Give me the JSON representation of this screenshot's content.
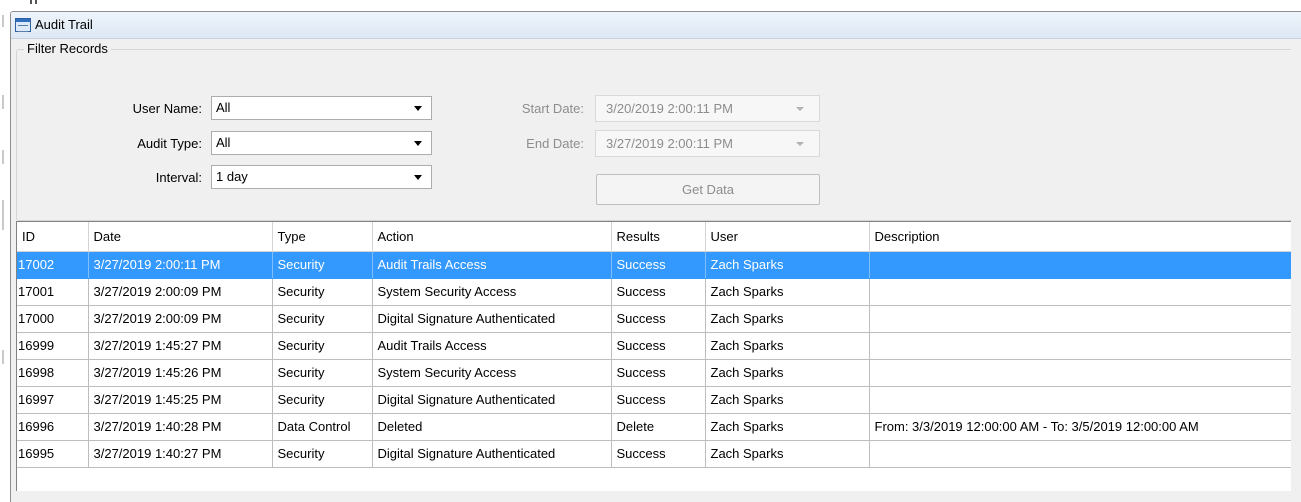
{
  "window": {
    "title": "Audit Trail"
  },
  "filter": {
    "legend": "Filter Records",
    "user_name": {
      "label": "User Name:",
      "value": "All"
    },
    "audit_type": {
      "label": "Audit Type:",
      "value": "All"
    },
    "interval": {
      "label": "Interval:",
      "value": "1 day"
    },
    "start_date": {
      "label": "Start Date:",
      "value": "3/20/2019  2:00:11 PM"
    },
    "end_date": {
      "label": "End Date:",
      "value": "3/27/2019  2:00:11 PM"
    },
    "get_data_label": "Get Data"
  },
  "grid": {
    "columns": [
      "ID",
      "Date",
      "Type",
      "Action",
      "Results",
      "User",
      "Description"
    ],
    "selected_index": 0,
    "rows": [
      {
        "id": "17002",
        "date": "3/27/2019 2:00:11 PM",
        "type": "Security",
        "action": "Audit Trails Access",
        "results": "Success",
        "user": "Zach Sparks",
        "description": ""
      },
      {
        "id": "17001",
        "date": "3/27/2019 2:00:09 PM",
        "type": "Security",
        "action": "System Security Access",
        "results": "Success",
        "user": "Zach Sparks",
        "description": ""
      },
      {
        "id": "17000",
        "date": "3/27/2019 2:00:09 PM",
        "type": "Security",
        "action": "Digital Signature Authenticated",
        "results": "Success",
        "user": "Zach Sparks",
        "description": ""
      },
      {
        "id": "16999",
        "date": "3/27/2019 1:45:27 PM",
        "type": "Security",
        "action": "Audit Trails Access",
        "results": "Success",
        "user": "Zach Sparks",
        "description": ""
      },
      {
        "id": "16998",
        "date": "3/27/2019 1:45:26 PM",
        "type": "Security",
        "action": "System Security Access",
        "results": "Success",
        "user": "Zach Sparks",
        "description": ""
      },
      {
        "id": "16997",
        "date": "3/27/2019 1:45:25 PM",
        "type": "Security",
        "action": "Digital Signature Authenticated",
        "results": "Success",
        "user": "Zach Sparks",
        "description": ""
      },
      {
        "id": "16996",
        "date": "3/27/2019 1:40:28 PM",
        "type": "Data Control",
        "action": "Deleted",
        "results": "Delete",
        "user": "Zach Sparks",
        "description": "From: 3/3/2019 12:00:00 AM - To: 3/5/2019 12:00:00 AM"
      },
      {
        "id": "16995",
        "date": "3/27/2019 1:40:27 PM",
        "type": "Security",
        "action": "Digital Signature Authenticated",
        "results": "Success",
        "user": "Zach Sparks",
        "description": ""
      }
    ]
  },
  "colors": {
    "selection": "#3399ff",
    "title_bar": "#dde8f4",
    "window_bg": "#f0f0f0"
  }
}
